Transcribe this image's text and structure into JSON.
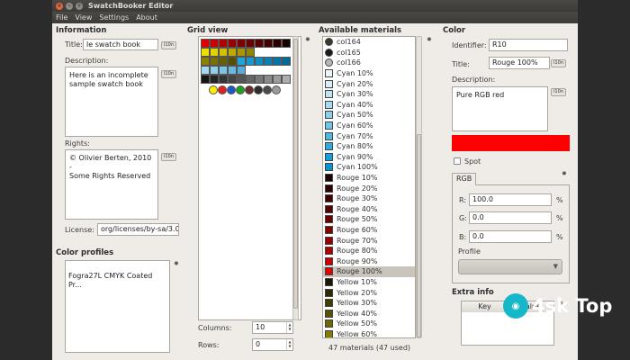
{
  "window": {
    "title": "SwatchBooker Editor",
    "menu": [
      "File",
      "View",
      "Settings",
      "About"
    ]
  },
  "information": {
    "header": "Information",
    "title_label": "Title:",
    "title_value": "le swatch book",
    "i10n": "i10n",
    "description_label": "Description:",
    "description_value": "Here is an incomplete\nsample swatch book",
    "rights_label": "Rights:",
    "rights_value": "© Olivier Berten, 2010 -\nSome Rights Reserved",
    "license_label": "License:",
    "license_value": "org/licenses/by-sa/3.0/"
  },
  "color_profiles": {
    "header": "Color profiles",
    "items": [
      "Fogra27L CMYK Coated Pr..."
    ]
  },
  "grid_view": {
    "header": "Grid view",
    "columns_label": "Columns:",
    "columns_value": "10",
    "rows_label": "Rows:",
    "rows_value": "0",
    "rows": [
      [
        "#e00000",
        "#c80000",
        "#b00000",
        "#980000",
        "#800000",
        "#6a0000",
        "#560000",
        "#420000",
        "#2c0000",
        "#160000"
      ],
      [
        "#f0e000",
        "#e2d200",
        "#d0c000",
        "#bcac00",
        "#a89800",
        "#928400"
      ],
      [
        "#8c8000",
        "#787000",
        "#666000",
        "#545000",
        "#1ea4d8",
        "#1898cc",
        "#128cbf",
        "#0c80b2",
        "#0674a6",
        "#006899"
      ],
      [
        "#a6d8ee",
        "#92cdea",
        "#7ec2e4",
        "#6ab8de",
        "#56addb"
      ],
      [
        "#141414",
        "#242424",
        "#343434",
        "#444444",
        "#545454",
        "#666666",
        "#787878",
        "#8a8a8a",
        "#9c9c9c",
        "#aeaeae"
      ]
    ],
    "dots": [
      "#ffee00",
      "#e02020",
      "#1e58c8",
      "#20a020",
      "#6c2a2a",
      "#2c2c2c",
      "#4a4a4a",
      "#9a9a9a"
    ]
  },
  "materials": {
    "header": "Available materials",
    "count": "47 materials (47 used)",
    "selected": "Rouge 100%",
    "items": [
      {
        "name": "col164",
        "color": "#3a3a2a",
        "round": true
      },
      {
        "name": "col165",
        "color": "#1a1a1a",
        "round": true
      },
      {
        "name": "col166",
        "color": "#b6b6b6",
        "round": true
      },
      {
        "name": "Cyan 10%",
        "color": "#eaf6fb"
      },
      {
        "name": "Cyan 20%",
        "color": "#d4eef8"
      },
      {
        "name": "Cyan 30%",
        "color": "#bfe5f4"
      },
      {
        "name": "Cyan 40%",
        "color": "#a6dbf0"
      },
      {
        "name": "Cyan 50%",
        "color": "#8cd0ec"
      },
      {
        "name": "Cyan 60%",
        "color": "#6fc4e7"
      },
      {
        "name": "Cyan 70%",
        "color": "#4fb8e2"
      },
      {
        "name": "Cyan 80%",
        "color": "#30abdd"
      },
      {
        "name": "Cyan 90%",
        "color": "#16a0d8"
      },
      {
        "name": "Cyan 100%",
        "color": "#0096d4"
      },
      {
        "name": "Rouge 10%",
        "color": "#1a0000"
      },
      {
        "name": "Rouge 20%",
        "color": "#2e0000"
      },
      {
        "name": "Rouge 30%",
        "color": "#420000"
      },
      {
        "name": "Rouge 40%",
        "color": "#560000"
      },
      {
        "name": "Rouge 50%",
        "color": "#6c0000"
      },
      {
        "name": "Rouge 60%",
        "color": "#820000"
      },
      {
        "name": "Rouge 70%",
        "color": "#980000"
      },
      {
        "name": "Rouge 80%",
        "color": "#b00000"
      },
      {
        "name": "Rouge 90%",
        "color": "#c80000"
      },
      {
        "name": "Rouge 100%",
        "color": "#e00000"
      },
      {
        "name": "Yellow 10%",
        "color": "#1a1800"
      },
      {
        "name": "Yellow 20%",
        "color": "#2e2a00"
      },
      {
        "name": "Yellow 30%",
        "color": "#423e00"
      },
      {
        "name": "Yellow 40%",
        "color": "#585200"
      },
      {
        "name": "Yellow 50%",
        "color": "#6e6800"
      },
      {
        "name": "Yellow 60%",
        "color": "#847c00"
      }
    ]
  },
  "color": {
    "header": "Color",
    "identifier_label": "Identifier:",
    "identifier_value": "R10",
    "title_label": "Title:",
    "title_value": "Rouge 100%",
    "description_label": "Description:",
    "description_value": "Pure RGB red",
    "preview_color": "#ff0000",
    "spot_label": "Spot",
    "tab_label": "RGB",
    "r_label": "R:",
    "r_value": "100.0",
    "g_label": "G:",
    "g_value": "0.0",
    "b_label": "B:",
    "b_value": "0.0",
    "unit": "%",
    "profile_label": "Profile"
  },
  "extra_info": {
    "header": "Extra info",
    "key_col": "Key",
    "value_col": "Value"
  },
  "watermark": {
    "text": "4sk Top"
  }
}
